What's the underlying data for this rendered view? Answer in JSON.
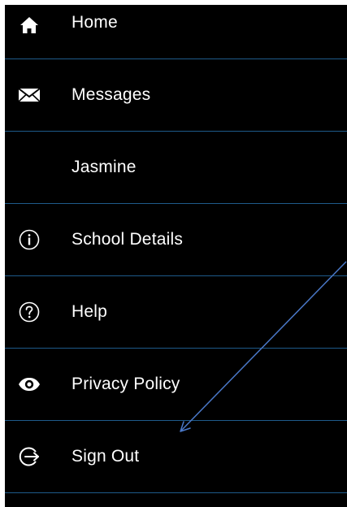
{
  "menu": {
    "items": [
      {
        "label": "Home",
        "icon": "home-icon"
      },
      {
        "label": "Messages",
        "icon": "envelope-icon"
      },
      {
        "label": "Jasmine",
        "icon": ""
      },
      {
        "label": "School Details",
        "icon": "info-circle-icon"
      },
      {
        "label": "Help",
        "icon": "question-circle-icon"
      },
      {
        "label": "Privacy Policy",
        "icon": "eye-icon"
      },
      {
        "label": "Sign Out",
        "icon": "sign-out-icon"
      }
    ]
  },
  "colors": {
    "background": "#000000",
    "divider": "#1e5a8a",
    "text": "#ffffff",
    "annotation_arrow": "#4a78c8"
  }
}
